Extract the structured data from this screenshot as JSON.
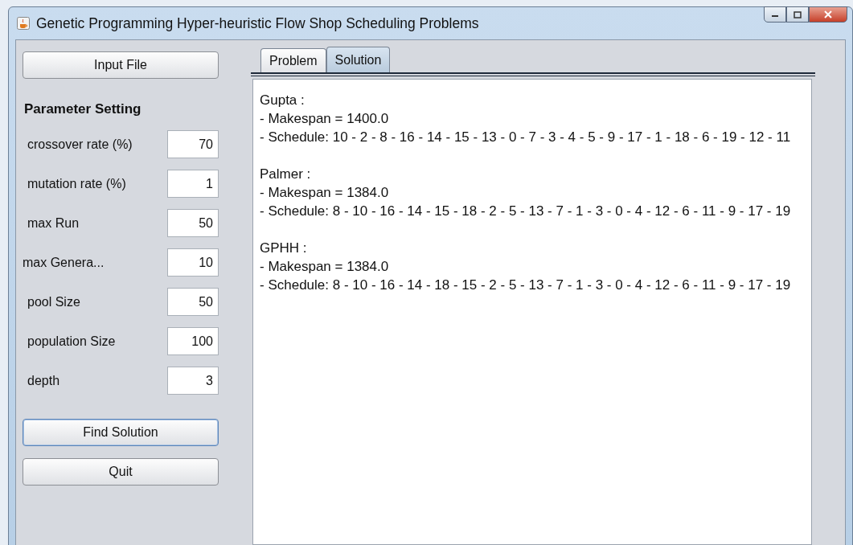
{
  "window": {
    "title": "Genetic Programming Hyper-heuristic Flow Shop Scheduling Problems"
  },
  "input_button": {
    "label": "Input File",
    "focused": false
  },
  "parameters": {
    "heading": "Parameter Setting",
    "fields": [
      {
        "label": "crossover rate (%)",
        "value": "70"
      },
      {
        "label": "mutation rate (%)",
        "value": "1"
      },
      {
        "label": "max Run",
        "value": "50"
      },
      {
        "label": "max Genera...",
        "value": "10"
      },
      {
        "label": "pool Size",
        "value": "50"
      },
      {
        "label": "population Size",
        "value": "100"
      },
      {
        "label": "depth",
        "value": "3"
      }
    ]
  },
  "action_buttons": [
    {
      "label": "Find Solution",
      "focused": true
    },
    {
      "label": "Quit",
      "focused": false
    }
  ],
  "tabs": [
    {
      "label": "Problem",
      "selected": false
    },
    {
      "label": "Solution",
      "selected": true
    }
  ],
  "results": [
    {
      "name": "Gupta  :",
      "lines": [
        "- Makespan = 1400.0",
        "- Schedule: 10 - 2 - 8 - 16 - 14 - 15 - 13 - 0 - 7 - 3 - 4 - 5 - 9 - 17 - 1 - 18 - 6 - 19 - 12 - 11"
      ]
    },
    {
      "name": "Palmer  :",
      "lines": [
        "- Makespan = 1384.0",
        "- Schedule: 8 - 10 - 16 - 14 - 15 - 18 - 2 - 5 - 13 - 7 - 1 - 3 - 0 - 4 - 12 - 6 - 11 - 9 - 17 - 19"
      ]
    },
    {
      "name": "GPHH   :",
      "lines": [
        "- Makespan = 1384.0",
        "- Schedule: 8 - 10 - 16 - 14 - 18 - 15 - 2 - 5 - 13 - 7 - 1 - 3 - 0 - 4 - 12 - 6 - 11 - 9 - 17 - 19"
      ]
    }
  ]
}
